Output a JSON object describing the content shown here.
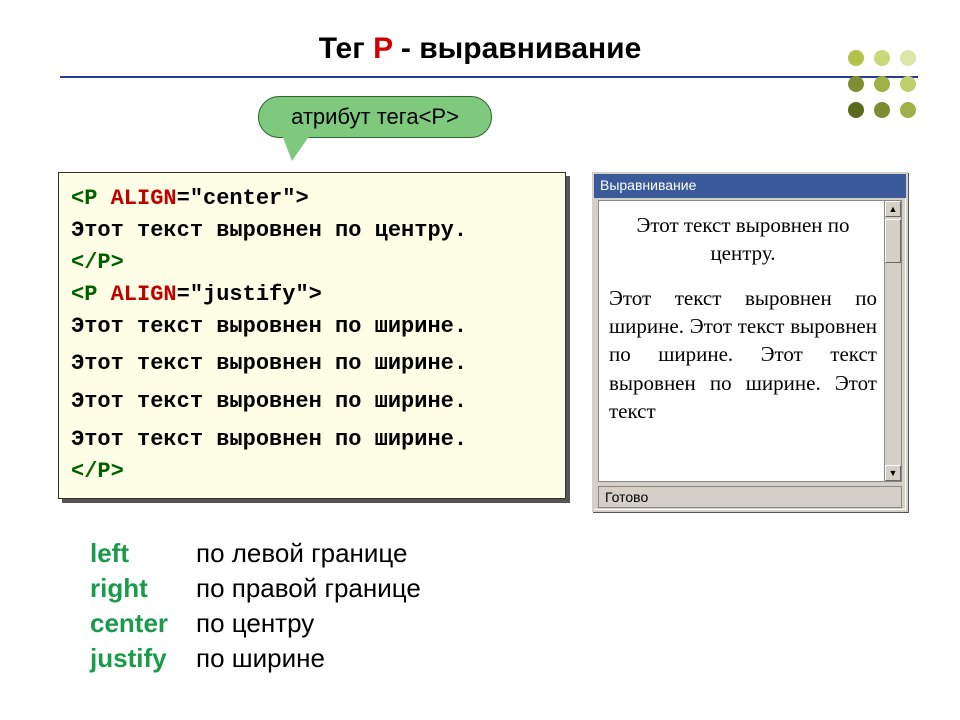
{
  "title": {
    "part1": "Тег ",
    "highlight": "P",
    "part2": " - выравнивание"
  },
  "pill": {
    "pre": "атрибут тега ",
    "tag": "<P>"
  },
  "code": {
    "l1a": "<P ",
    "l1b": "ALIGN",
    "l1c": "=\"center\">",
    "l2": "Этот текст выровнен по центру.",
    "l3": "</P>",
    "l4a": "<P ",
    "l4b": "ALIGN",
    "l4c": "=\"justify\">",
    "l5": "Этот текст выровнен по ширине.",
    "l6": "Этот текст выровнен по ширине.",
    "l7": "Этот текст выровнен по ширине.",
    "l8": "Этот текст выровнен по ширине.",
    "l9": "</P>"
  },
  "preview": {
    "title": "Выравнивание",
    "p1": "Этот текст выровнен по центру.",
    "p2": "Этот текст выровнен по ширине. Этот текст выровнен по ширине. Этот текст выровнен по ширине. Этот текст",
    "status": "Готово"
  },
  "legend": [
    {
      "k": "left",
      "v": "по левой границе"
    },
    {
      "k": "right",
      "v": "по правой границе"
    },
    {
      "k": "center",
      "v": "по центру"
    },
    {
      "k": "justify",
      "v": "по ширине"
    }
  ]
}
